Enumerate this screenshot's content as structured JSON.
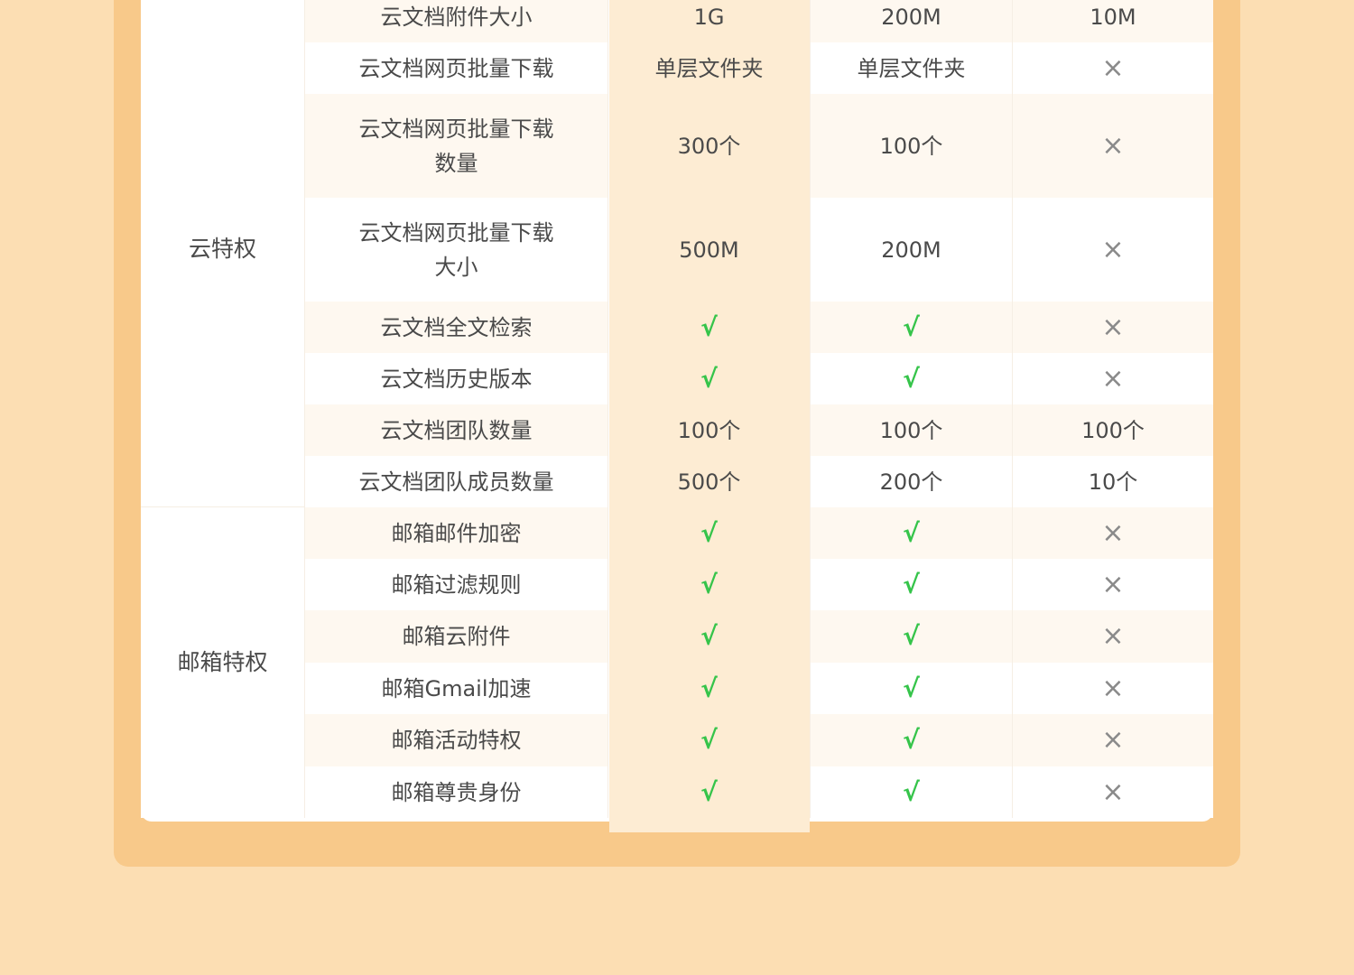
{
  "categories": [
    {
      "label": "云特权"
    },
    {
      "label": "邮箱特权"
    }
  ],
  "rows": [
    {
      "feature": "云文档附件大小",
      "col1": "1G",
      "col2": "200M",
      "col3": "10M"
    },
    {
      "feature": "云文档网页批量下载",
      "col1": "单层文件夹",
      "col2": "单层文件夹",
      "col3": "×"
    },
    {
      "feature": "云文档网页批量下载\n数量",
      "col1": "300个",
      "col2": "100个",
      "col3": "×"
    },
    {
      "feature": "云文档网页批量下载\n大小",
      "col1": "500M",
      "col2": "200M",
      "col3": "×"
    },
    {
      "feature": "云文档全文检索",
      "col1": "√",
      "col2": "√",
      "col3": "×"
    },
    {
      "feature": "云文档历史版本",
      "col1": "√",
      "col2": "√",
      "col3": "×"
    },
    {
      "feature": "云文档团队数量",
      "col1": "100个",
      "col2": "100个",
      "col3": "100个"
    },
    {
      "feature": "云文档团队成员数量",
      "col1": "500个",
      "col2": "200个",
      "col3": "10个"
    },
    {
      "feature": "邮箱邮件加密",
      "col1": "√",
      "col2": "√",
      "col3": "×"
    },
    {
      "feature": "邮箱过滤规则",
      "col1": "√",
      "col2": "√",
      "col3": "×"
    },
    {
      "feature": "邮箱云附件",
      "col1": "√",
      "col2": "√",
      "col3": "×"
    },
    {
      "feature": "邮箱Gmail加速",
      "col1": "√",
      "col2": "√",
      "col3": "×"
    },
    {
      "feature": "邮箱活动特权",
      "col1": "√",
      "col2": "√",
      "col3": "×"
    },
    {
      "feature": "邮箱尊贵身份",
      "col1": "√",
      "col2": "√",
      "col3": "×"
    }
  ],
  "colors": {
    "background": "#fcdeb3",
    "panel": "#f8c98a",
    "highlight_column": "#fdecd3",
    "check": "#35c44a",
    "cross": "#8a8a8a",
    "text": "#4a4a4a"
  }
}
